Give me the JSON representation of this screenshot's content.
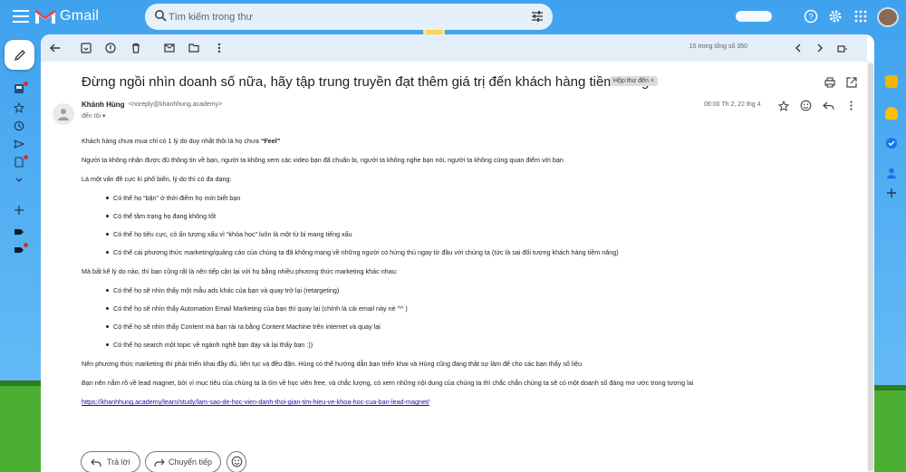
{
  "app": {
    "name": "Gmail"
  },
  "search": {
    "placeholder": "Tìm kiếm trong thư"
  },
  "toolbar": {
    "pager": "15 trong tổng số 350"
  },
  "email": {
    "subject": "Đừng ngồi nhìn doanh số nữa, hãy tập trung truyền đạt thêm giá trị đến khách hàng tiềm năng",
    "label": "Hộp thư đến ×",
    "sender_name": "Khánh Hùng",
    "sender_email": "<noreply@khanhhung.academy>",
    "to": "đến tôi ▾",
    "date": "06:00 Th 2, 22 thg 4",
    "p1_prefix": "Khách hàng chưa mua chỉ có 1 lý do duy nhất thôi là họ chưa ",
    "p1_bold": "“Feel”",
    "p2": "Người ta không nhận được đủ thông tin về bạn, người ta không xem các video bạn đã chuẩn bị, người ta không nghe bạn nói, người ta không cùng quan điểm với bạn",
    "p3": "Là một vấn đề cực kì phổ biến, lý do thì có đa dạng:",
    "list1": [
      "Có thể họ “bận” ở thời điểm họ mới biết bạn",
      "Có thể tâm trạng họ đang không tốt",
      "Có thể họ tiêu cực, có ấn tượng xấu vì “khóa học” luôn là một từ bị mang tiếng xấu",
      "Có thể cái phương thức marketing/quảng cáo của chúng ta đã không mang về những người có hứng thú ngay từ đầu với chúng ta (tức là sai đối tượng khách hàng tiềm năng)"
    ],
    "p4": "Mà bất kể lý do nào, thì bạn cũng rất là nên tiếp cận lại với họ bằng nhiều phương thức marketing khác nhau:",
    "list2": [
      "Có thể họ sẽ nhìn thấy một mẫu ads khác của bạn và quay trở lại (retargeting)",
      "Có thể họ sẽ nhìn thấy Automation Email Marketing của bạn thì quay lại (chính là cái email này nè ^^ )",
      "Có thể họ sẽ nhìn thấy Content mà bạn rải ra bằng Content Machine trên internet và quay lại",
      "Có thể họ search một topic về ngành nghề bạn dạy và lại thấy bạn :))"
    ],
    "p5": "Nên phương thức marketing thì phải triển khai đầy đủ, liên tục và đều đặn. Hùng có thể hướng dẫn bạn triển khai và Hùng cũng đang thật sự làm để cho các bạn thấy số liệu",
    "p6": "Bạn nên nắm rõ về lead magnet, bởi vì mục tiêu của chúng ta là tìm về học viên free, và chắc lượng, có xem những nội dung của chúng ta thì chắc chắn chúng ta sẽ có một doanh số đáng mơ ước trong tương lai",
    "link": "https://khanhhung.academy/learn/study/lam-sao-de-hoc-vien-danh-thoi-gian-tim-hieu-ve-khoa-hoc-cua-ban-lead-magnet/"
  },
  "actions": {
    "reply": "Trả lời",
    "forward": "Chuyển tiếp"
  },
  "colors": {
    "accent": "#0b57d0",
    "theme_sky": "#4aa9f0",
    "grass": "#4caf34"
  }
}
